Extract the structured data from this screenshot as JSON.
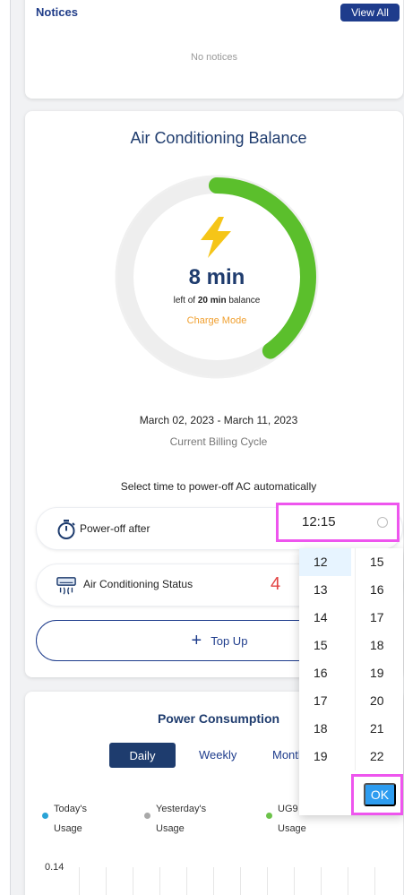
{
  "notices": {
    "title": "Notices",
    "view_all_label": "View All",
    "empty_text": "No notices"
  },
  "ac_balance": {
    "title": "Air Conditioning Balance",
    "value": "8 min",
    "sub_prefix": "left of",
    "sub_total": "20 min",
    "sub_suffix": "balance",
    "mode": "Charge Mode",
    "remaining_fraction": 0.4,
    "billing_dates": "March 02, 2023 - March 11, 2023",
    "billing_label": "Current Billing Cycle",
    "colors": {
      "gauge_fill": "#5bbf2c",
      "gauge_track": "#eeeeee",
      "bolt": "#f5c518",
      "mode": "#f0a030"
    }
  },
  "auto_poweroff": {
    "prompt": "Select time to power-off AC automatically",
    "label": "Power-off after",
    "time_value": "12:15",
    "icon": "timer-icon"
  },
  "ac_status": {
    "label": "Air Conditioning Status",
    "icon": "air-conditioner-icon"
  },
  "annotation_step": "4",
  "topup": {
    "label": "Top Up",
    "icon": "plus-icon"
  },
  "power_consumption": {
    "title": "Power Consumption",
    "tabs": [
      "Daily",
      "Weekly",
      "Monthly"
    ],
    "active_tab": "Daily",
    "legend": [
      {
        "line1": "Today's",
        "line2": "Usage",
        "color": "#2aa3d6"
      },
      {
        "line1": "Yesterday's",
        "line2": "Usage",
        "color": "#a9a9a9"
      },
      {
        "line1": "UG9",
        "line2": "Usage",
        "color": "#6cc24a"
      }
    ],
    "y_top_label": "0.14"
  },
  "time_picker": {
    "hours": [
      "12",
      "13",
      "14",
      "15",
      "16",
      "17",
      "18",
      "19"
    ],
    "minutes": [
      "15",
      "16",
      "17",
      "18",
      "19",
      "20",
      "21",
      "22"
    ],
    "selected_hour": "12",
    "ok_label": "OK"
  }
}
